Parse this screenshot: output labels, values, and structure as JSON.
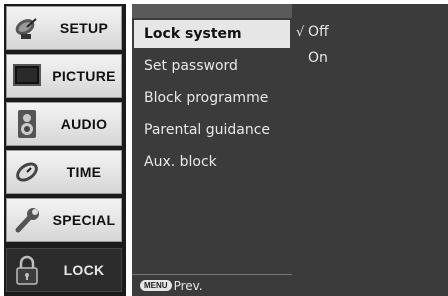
{
  "categories": [
    {
      "label": "SETUP",
      "icon": "satellite-dish-icon"
    },
    {
      "label": "PICTURE",
      "icon": "tv-screen-icon"
    },
    {
      "label": "AUDIO",
      "icon": "speaker-icon"
    },
    {
      "label": "TIME",
      "icon": "clock-icon"
    },
    {
      "label": "SPECIAL",
      "icon": "wrench-icon"
    },
    {
      "label": "LOCK",
      "icon": "padlock-icon"
    }
  ],
  "active_category": "LOCK",
  "submenu": {
    "items": [
      "Lock system",
      "Set password",
      "Block programme",
      "Parental guidance",
      "Aux. block"
    ],
    "selected": "Lock system"
  },
  "options": {
    "items": [
      "Off",
      "On"
    ],
    "checked": "Off",
    "check_mark": "√"
  },
  "footer": {
    "key": "MENU",
    "label": "Prev."
  },
  "colors": {
    "panel": "#3b3b3b",
    "highlight": "#e6e6e6",
    "sidebar_bg": "#1b1b1b"
  }
}
